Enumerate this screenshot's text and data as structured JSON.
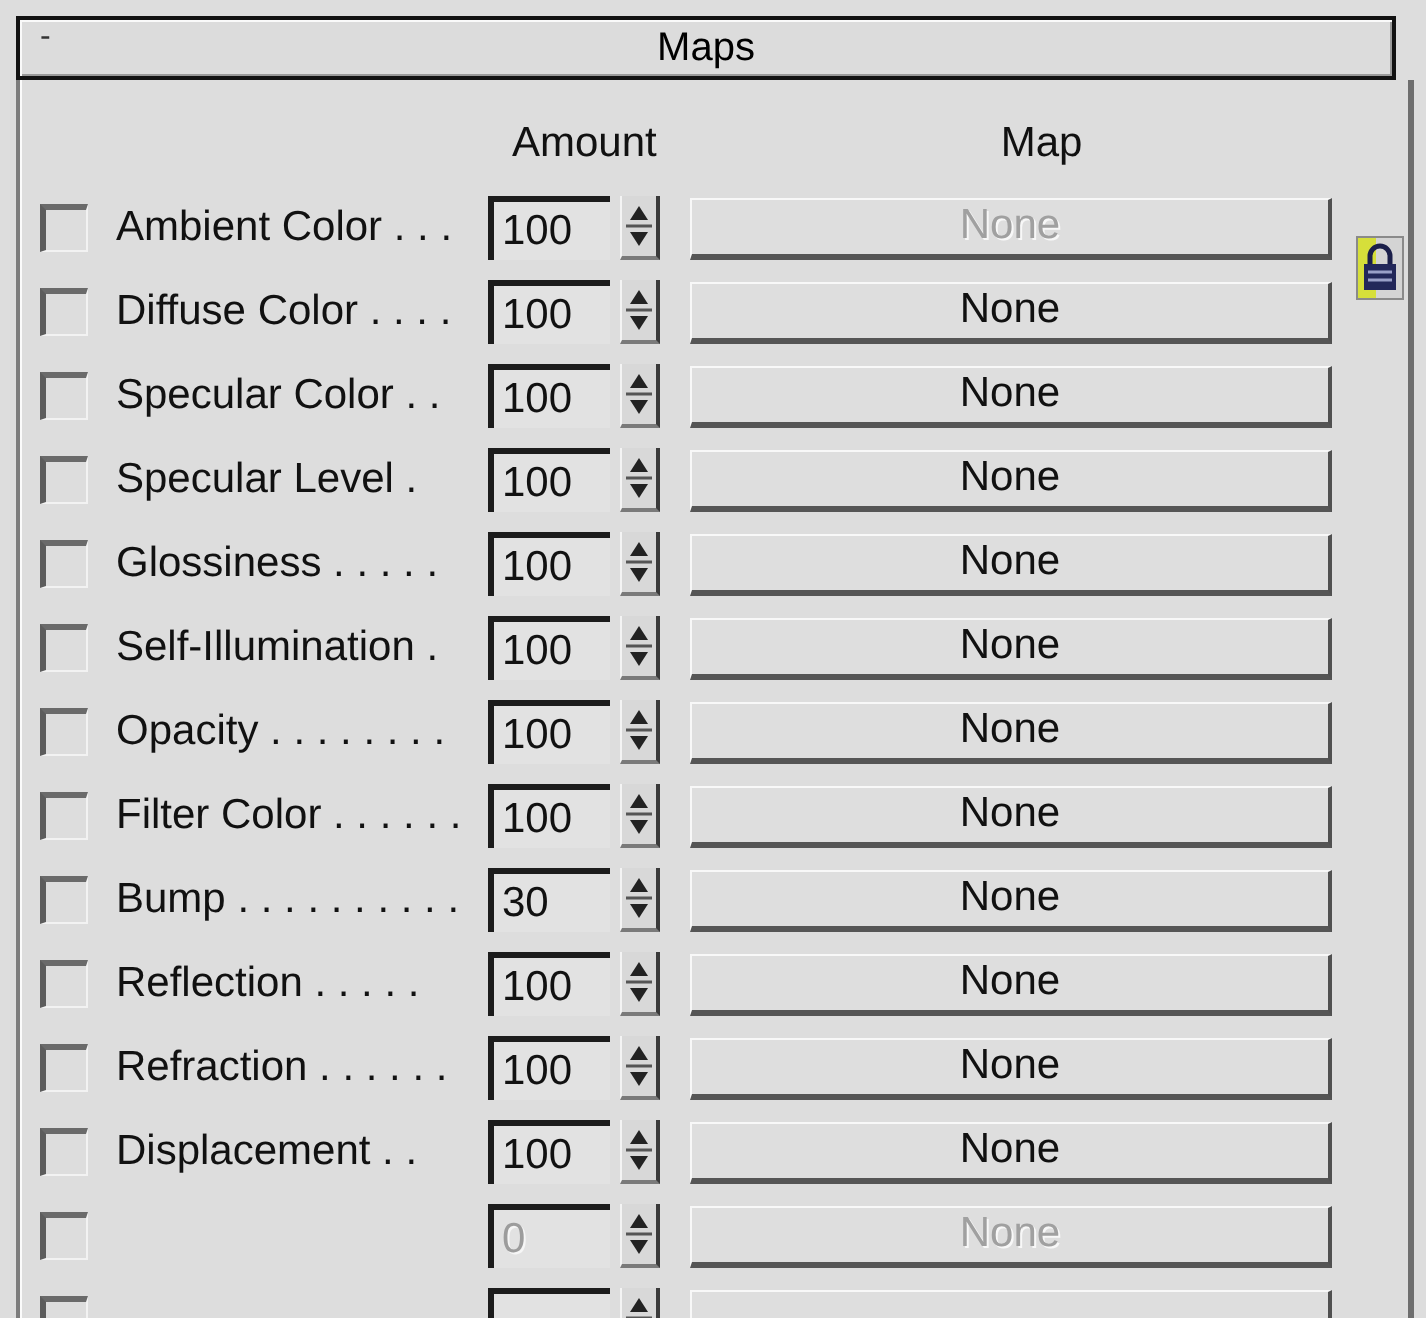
{
  "rollout": {
    "collapse_sign": "-",
    "title": "Maps"
  },
  "columns": {
    "amount": "Amount",
    "map": "Map"
  },
  "lock": {
    "on": true
  },
  "maps": [
    {
      "label": "Ambient Color . . .",
      "checked": false,
      "amount": "100",
      "amount_disabled": false,
      "map": "None",
      "map_disabled": true
    },
    {
      "label": "Diffuse Color . . . .",
      "checked": false,
      "amount": "100",
      "amount_disabled": false,
      "map": "None",
      "map_disabled": false
    },
    {
      "label": "Specular Color . .",
      "checked": false,
      "amount": "100",
      "amount_disabled": false,
      "map": "None",
      "map_disabled": false
    },
    {
      "label": "Specular Level .",
      "checked": false,
      "amount": "100",
      "amount_disabled": false,
      "map": "None",
      "map_disabled": false
    },
    {
      "label": "Glossiness . . . . .",
      "checked": false,
      "amount": "100",
      "amount_disabled": false,
      "map": "None",
      "map_disabled": false
    },
    {
      "label": "Self-Illumination .",
      "checked": false,
      "amount": "100",
      "amount_disabled": false,
      "map": "None",
      "map_disabled": false
    },
    {
      "label": "Opacity . . . . . . . .",
      "checked": false,
      "amount": "100",
      "amount_disabled": false,
      "map": "None",
      "map_disabled": false
    },
    {
      "label": "Filter Color . . . . . .",
      "checked": false,
      "amount": "100",
      "amount_disabled": false,
      "map": "None",
      "map_disabled": false
    },
    {
      "label": "Bump . . . . . . . . . .",
      "checked": false,
      "amount": "30",
      "amount_disabled": false,
      "map": "None",
      "map_disabled": false
    },
    {
      "label": "Reflection . . . . .",
      "checked": false,
      "amount": "100",
      "amount_disabled": false,
      "map": "None",
      "map_disabled": false
    },
    {
      "label": "Refraction . . . . . .",
      "checked": false,
      "amount": "100",
      "amount_disabled": false,
      "map": "None",
      "map_disabled": false
    },
    {
      "label": "Displacement . .",
      "checked": false,
      "amount": "100",
      "amount_disabled": false,
      "map": "None",
      "map_disabled": false
    },
    {
      "checked": false,
      "amount": "0",
      "amount_disabled": true,
      "map": "None",
      "map_disabled": true
    },
    {
      "checked": false
    }
  ]
}
